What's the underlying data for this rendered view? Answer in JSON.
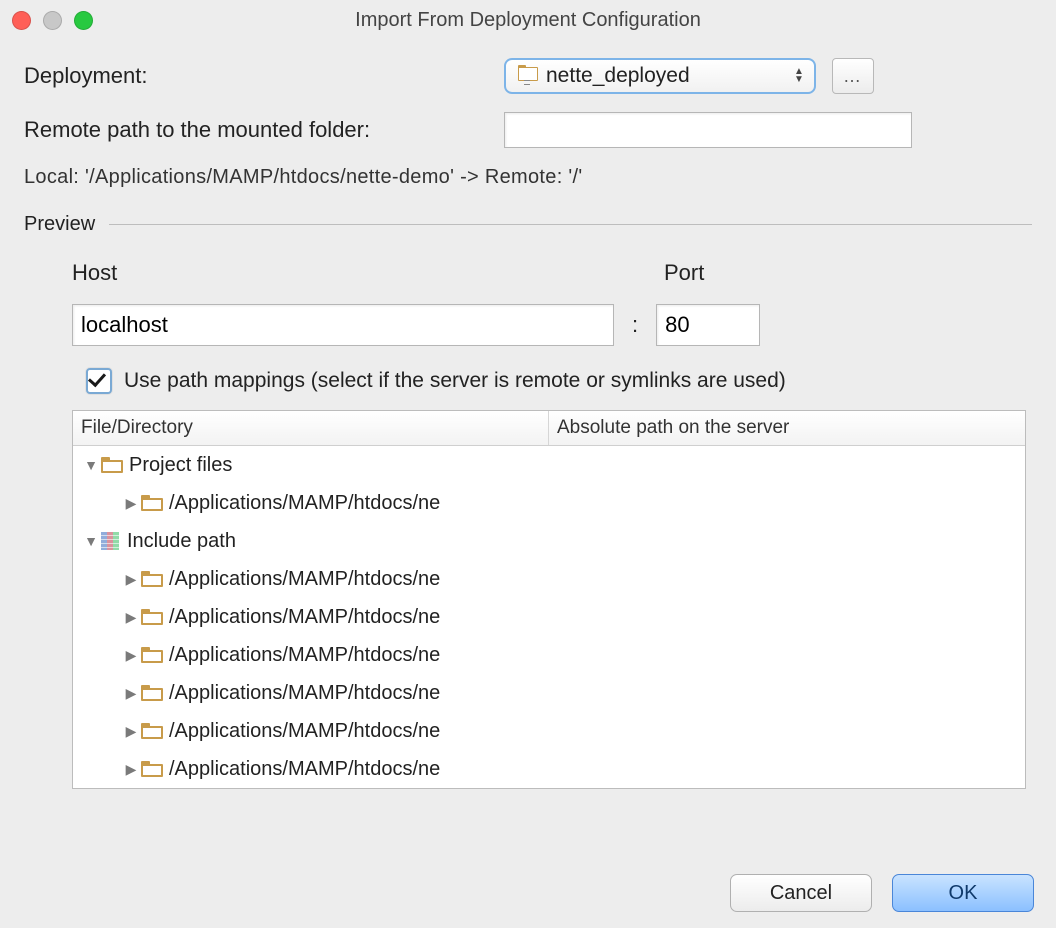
{
  "window": {
    "title": "Import From Deployment Configuration"
  },
  "deployment": {
    "label": "Deployment:",
    "selected": "nette_deployed"
  },
  "remote_path": {
    "label": "Remote path to the mounted folder:",
    "value": ""
  },
  "mapping_line": "Local: '/Applications/MAMP/htdocs/nette-demo' -> Remote: '/'",
  "preview": {
    "label": "Preview",
    "host_label": "Host",
    "port_label": "Port",
    "host_value": "localhost",
    "port_value": "80",
    "colon": ":",
    "use_mappings_label": "Use path mappings (select if the server is remote or symlinks are used)",
    "use_mappings_checked": true,
    "columns": {
      "file_dir": "File/Directory",
      "abs_path": "Absolute path on the server"
    },
    "tree": [
      {
        "depth": 0,
        "expanded": true,
        "icon": "folder",
        "label": "Project files"
      },
      {
        "depth": 1,
        "expanded": false,
        "icon": "folder",
        "label": "/Applications/MAMP/htdocs/ne"
      },
      {
        "depth": 0,
        "expanded": true,
        "icon": "library",
        "label": "Include path"
      },
      {
        "depth": 1,
        "expanded": false,
        "icon": "folder",
        "label": "/Applications/MAMP/htdocs/ne"
      },
      {
        "depth": 1,
        "expanded": false,
        "icon": "folder",
        "label": "/Applications/MAMP/htdocs/ne"
      },
      {
        "depth": 1,
        "expanded": false,
        "icon": "folder",
        "label": "/Applications/MAMP/htdocs/ne"
      },
      {
        "depth": 1,
        "expanded": false,
        "icon": "folder",
        "label": "/Applications/MAMP/htdocs/ne"
      },
      {
        "depth": 1,
        "expanded": false,
        "icon": "folder",
        "label": "/Applications/MAMP/htdocs/ne"
      },
      {
        "depth": 1,
        "expanded": false,
        "icon": "folder",
        "label": "/Applications/MAMP/htdocs/ne"
      }
    ]
  },
  "buttons": {
    "cancel": "Cancel",
    "ok": "OK"
  }
}
